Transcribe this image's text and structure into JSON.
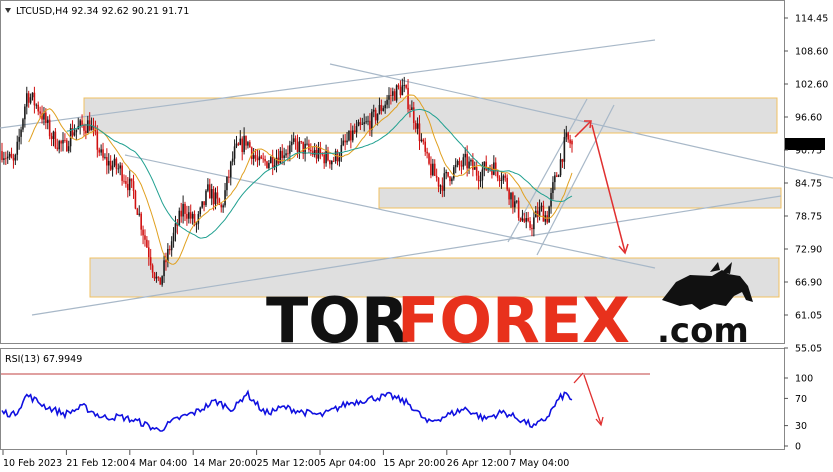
{
  "header": {
    "symbol_info": "LTCUSD,H4  92.34 92.62 90.21 91.71",
    "rsi_info": "RSI(13) 67.9949"
  },
  "price_axis": {
    "labels": [
      "114.45",
      "108.60",
      "102.60",
      "96.60",
      "90.75",
      "84.75",
      "78.75",
      "72.90",
      "66.90",
      "61.05",
      "55.05"
    ],
    "current_price_label": "91.71"
  },
  "rsi_axis": {
    "labels": [
      "100",
      "70",
      "30",
      "0"
    ]
  },
  "time_axis": {
    "labels": [
      "10 Feb 2023",
      "21 Feb 12:00",
      "4 Mar 04:00",
      "14 Mar 20:00",
      "25 Mar 12:00",
      "5 Apr 04:00",
      "15 Apr 20:00",
      "26 Apr 12:00",
      "7 May 04:00"
    ]
  },
  "watermark": {
    "part1": "TOR",
    "part2": "FOREX",
    "part3": ".com",
    "logo_icon": "bull-icon"
  },
  "colors": {
    "bull_candle": "#1a1a1a",
    "bear_candle": "#d01010",
    "ma_fast": "#e0a020",
    "ma_slow": "#20a090",
    "rsi_line": "#1010e0",
    "zone_fill": "#d9d9d9",
    "zone_border": "#f0c060",
    "trendline": "#a8b8c8",
    "forecast_arrow": "#e03030",
    "brand_red": "#e8311c"
  },
  "chart_data": [
    {
      "type": "candlestick",
      "title": "LTCUSD,H4",
      "ohlc_last": {
        "open": 92.34,
        "high": 92.62,
        "low": 90.21,
        "close": 91.71
      },
      "ylim": [
        55.05,
        114.45
      ],
      "x_start": "2023-02-10",
      "x_end": "2023-05-12",
      "close_path": [
        [
          "2023-02-10",
          90.5
        ],
        [
          "2023-02-12",
          88.0
        ],
        [
          "2023-02-14",
          101.0
        ],
        [
          "2023-02-16",
          98.0
        ],
        [
          "2023-02-18",
          93.0
        ],
        [
          "2023-02-20",
          91.0
        ],
        [
          "2023-02-21",
          94.0
        ],
        [
          "2023-02-24",
          95.5
        ],
        [
          "2023-02-26",
          89.0
        ],
        [
          "2023-03-01",
          87.0
        ],
        [
          "2023-03-03",
          83.0
        ],
        [
          "2023-03-05",
          74.0
        ],
        [
          "2023-03-07",
          66.0
        ],
        [
          "2023-03-09",
          74.0
        ],
        [
          "2023-03-11",
          80.5
        ],
        [
          "2023-03-13",
          77.0
        ],
        [
          "2023-03-15",
          83.5
        ],
        [
          "2023-03-17",
          80.0
        ],
        [
          "2023-03-19",
          90.0
        ],
        [
          "2023-03-21",
          92.5
        ],
        [
          "2023-03-23",
          88.0
        ],
        [
          "2023-03-25",
          89.0
        ],
        [
          "2023-03-27",
          90.5
        ],
        [
          "2023-03-29",
          91.5
        ],
        [
          "2023-04-01",
          90.0
        ],
        [
          "2023-04-04",
          89.0
        ],
        [
          "2023-04-07",
          93.5
        ],
        [
          "2023-04-10",
          96.0
        ],
        [
          "2023-04-13",
          100.5
        ],
        [
          "2023-04-15",
          102.0
        ],
        [
          "2023-04-17",
          96.0
        ],
        [
          "2023-04-19",
          88.0
        ],
        [
          "2023-04-21",
          84.5
        ],
        [
          "2023-04-23",
          87.0
        ],
        [
          "2023-04-25",
          88.5
        ],
        [
          "2023-04-27",
          86.5
        ],
        [
          "2023-04-29",
          88.0
        ],
        [
          "2023-05-01",
          86.0
        ],
        [
          "2023-05-03",
          80.5
        ],
        [
          "2023-05-05",
          76.5
        ],
        [
          "2023-05-07",
          80.0
        ],
        [
          "2023-05-08",
          78.5
        ],
        [
          "2023-05-09",
          84.0
        ],
        [
          "2023-05-10",
          88.0
        ],
        [
          "2023-05-11",
          92.5
        ],
        [
          "2023-05-12",
          91.71
        ]
      ]
    },
    {
      "type": "line",
      "title": "RSI(13) 67.9949",
      "ylim": [
        0,
        100
      ],
      "levels": [
        30,
        70
      ],
      "last_value": 67.9949,
      "path": [
        [
          "2023-02-10",
          50
        ],
        [
          "2023-02-12",
          46
        ],
        [
          "2023-02-14",
          75
        ],
        [
          "2023-02-17",
          58
        ],
        [
          "2023-02-20",
          47
        ],
        [
          "2023-02-23",
          58
        ],
        [
          "2023-02-26",
          42
        ],
        [
          "2023-03-01",
          43
        ],
        [
          "2023-03-04",
          35
        ],
        [
          "2023-03-07",
          23
        ],
        [
          "2023-03-10",
          40
        ],
        [
          "2023-03-13",
          50
        ],
        [
          "2023-03-16",
          66
        ],
        [
          "2023-03-19",
          54
        ],
        [
          "2023-03-21",
          78
        ],
        [
          "2023-03-24",
          48
        ],
        [
          "2023-03-27",
          57
        ],
        [
          "2023-03-30",
          50
        ],
        [
          "2023-04-02",
          45
        ],
        [
          "2023-04-06",
          62
        ],
        [
          "2023-04-10",
          70
        ],
        [
          "2023-04-13",
          74
        ],
        [
          "2023-04-16",
          62
        ],
        [
          "2023-04-19",
          34
        ],
        [
          "2023-04-22",
          45
        ],
        [
          "2023-04-25",
          55
        ],
        [
          "2023-04-28",
          40
        ],
        [
          "2023-05-01",
          50
        ],
        [
          "2023-05-04",
          38
        ],
        [
          "2023-05-06",
          28
        ],
        [
          "2023-05-08",
          42
        ],
        [
          "2023-05-10",
          70
        ],
        [
          "2023-05-11",
          77
        ],
        [
          "2023-05-12",
          67.9949
        ]
      ]
    }
  ]
}
